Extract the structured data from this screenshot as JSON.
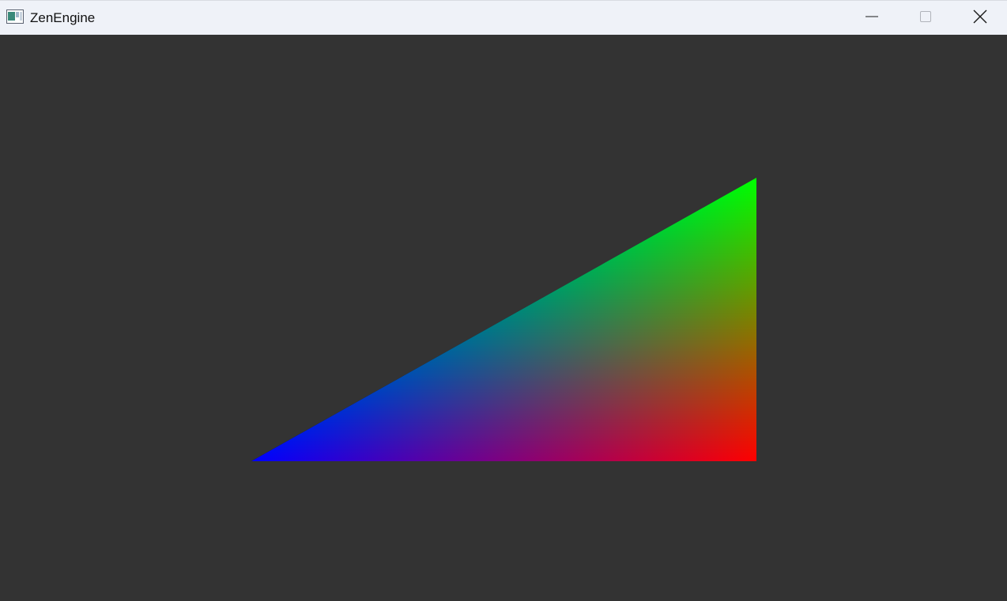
{
  "window": {
    "title": "ZenEngine",
    "icon": "app-window-icon"
  },
  "controls": {
    "minimize_icon": "minimize-icon",
    "maximize_icon": "maximize-icon",
    "close_icon": "close-icon"
  },
  "scene": {
    "background_color": "#333333",
    "vertex_colors": {
      "bottom_left": "#0000ff",
      "top_right": "#00ff00",
      "bottom_right": "#ff0000"
    }
  }
}
